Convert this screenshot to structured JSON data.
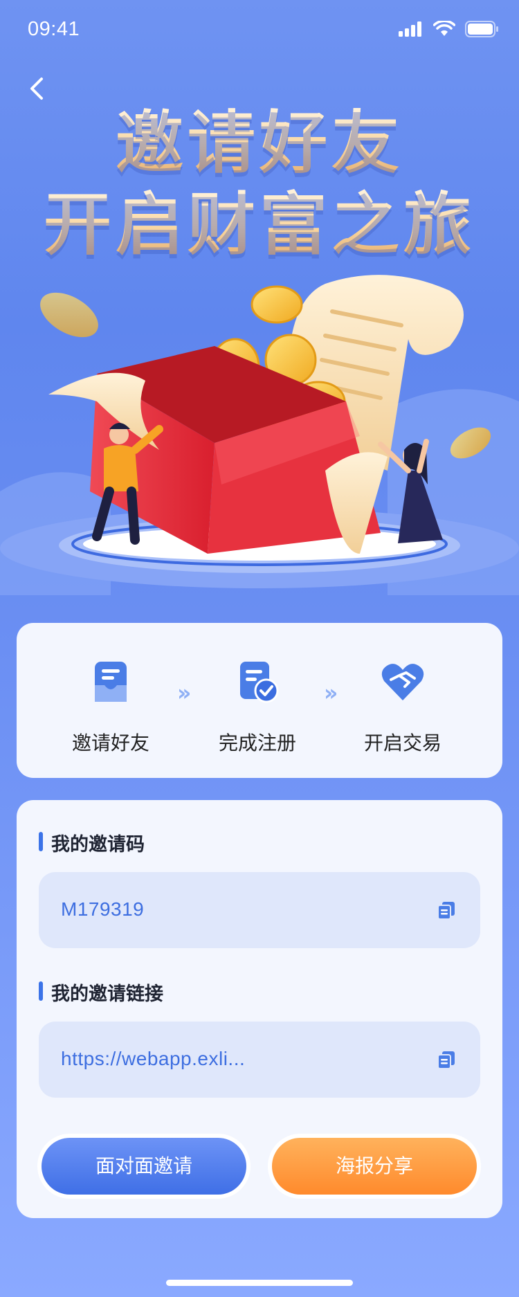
{
  "status_bar": {
    "time": "09:41"
  },
  "nav": {
    "back_icon": "chevron-left-icon"
  },
  "headline": {
    "line1": "邀请好友",
    "line2": "开启财富之旅"
  },
  "steps": [
    {
      "label": "邀请好友",
      "icon": "inbox-icon"
    },
    {
      "label": "完成注册",
      "icon": "document-check-icon"
    },
    {
      "label": "开启交易",
      "icon": "handshake-heart-icon"
    }
  ],
  "invite_code": {
    "title": "我的邀请码",
    "value": "M179319",
    "copy_icon": "copy-icon"
  },
  "invite_link": {
    "title": "我的邀请链接",
    "value": "https://webapp.exli...",
    "copy_icon": "copy-icon"
  },
  "buttons": {
    "face_to_face": "面对面邀请",
    "poster_share": "海报分享"
  },
  "colors": {
    "primary": "#3f6fe6",
    "accent": "#ff8a2c",
    "background": "#6f93f2"
  }
}
